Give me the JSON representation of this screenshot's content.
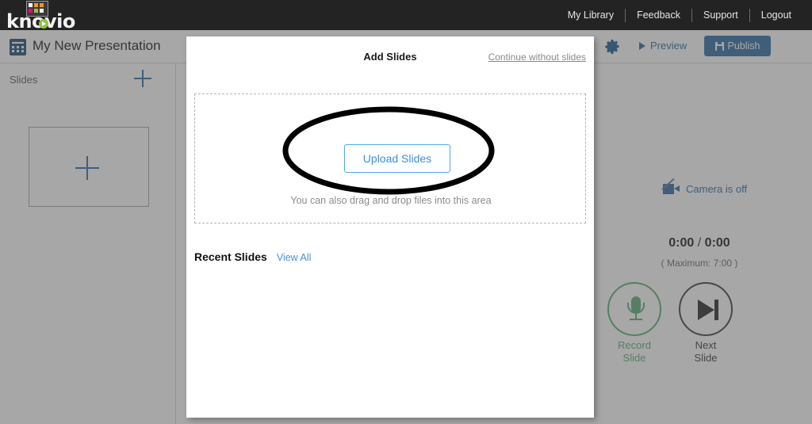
{
  "topbar": {
    "logo_text": "knovio",
    "logo_icon": "knovio-grid-logo",
    "nav": [
      {
        "label": "My Library",
        "name": "nav-my-library"
      },
      {
        "label": "Feedback",
        "name": "nav-feedback"
      },
      {
        "label": "Support",
        "name": "nav-support"
      },
      {
        "label": "Logout",
        "name": "nav-logout"
      }
    ]
  },
  "titlebar": {
    "presentation_title": "My New Presentation",
    "preview_label": "Preview",
    "publish_label": "Publish",
    "gear_icon": "gear-icon"
  },
  "sidebar": {
    "slides_label": "Slides",
    "add_slide_icon": "plus-icon",
    "thumb_add_icon": "plus-icon"
  },
  "recorder": {
    "camera_status": "Camera is off",
    "camera_icon": "camera-off-icon",
    "time_current": "0:00",
    "time_separator": "/",
    "time_total": "0:00",
    "time_display": "0:00 / 0:00",
    "maximum_label": "( Maximum: 7:00 )",
    "record_label": "Record\nSlide",
    "record_label_line1": "Record",
    "record_label_line2": "Slide",
    "next_label_line1": "Next",
    "next_label_line2": "Slide",
    "mic_icon": "microphone-icon",
    "next_icon": "skip-forward-icon"
  },
  "modal": {
    "title": "Add Slides",
    "continue_link": "Continue without slides",
    "upload_button": "Upload Slides",
    "drop_hint": "You can also drag and drop files into this area",
    "recent_title": "Recent Slides",
    "view_all": "View All"
  },
  "colors": {
    "topbar_bg": "#232323",
    "accent_blue": "#2e6da4",
    "link_blue": "#4a90d9",
    "upload_blue": "#3b8fe0",
    "record_green": "#5bae76",
    "logo_green": "#8dc63f",
    "overlay": "#505050",
    "annotation": "#000000"
  }
}
